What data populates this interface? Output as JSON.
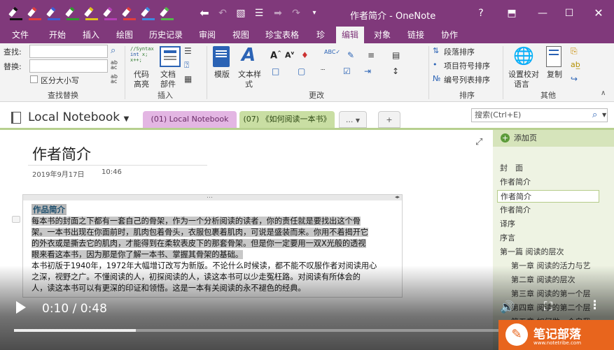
{
  "window": {
    "title": "作者简介 - OneNote",
    "help_label": "?",
    "controls": [
      "restore-ribbon",
      "minimize",
      "maximize",
      "close"
    ]
  },
  "pens": [
    {
      "color": "#111111"
    },
    {
      "color": "#e23d3d"
    },
    {
      "color": "#3b5ed6"
    },
    {
      "color": "#2e9b2e"
    },
    {
      "color": "#e0c21b"
    },
    {
      "color": "#b53fb5"
    },
    {
      "color": "#e23d3d"
    },
    {
      "color": "#3c8ae0"
    },
    {
      "color": "#53b84a"
    }
  ],
  "menu": {
    "tabs": [
      "文件",
      "开始",
      "插入",
      "绘图",
      "历史记录",
      "审阅",
      "视图",
      "珍宝表格",
      "珍",
      "编辑",
      "对象",
      "链接",
      "协作"
    ],
    "active": "编辑"
  },
  "ribbon": {
    "find_label": "查找:",
    "replace_label": "替换:",
    "find_value": "",
    "replace_value": "",
    "match_case_label": "区分大小写",
    "code_label": "代码\n高亮",
    "code_label_1": "代码",
    "code_label_2": "高亮",
    "doc_parts_1": "文档",
    "doc_parts_2": "部件",
    "template_label": "模版",
    "text_style_1": "文本样",
    "text_style_2": "式",
    "sort_paragraph": "段落排序",
    "sort_bullets": "项目符号排序",
    "sort_numbers": "编号列表排序",
    "proof_lang_1": "设置校对",
    "proof_lang_2": "语言",
    "copy_label": "复制",
    "groups": {
      "find_replace": "查找替换",
      "insert": "插入",
      "change": "更改",
      "sort": "排序",
      "other": "其他"
    }
  },
  "notebook": {
    "name": "Local Notebook",
    "sections": [
      {
        "label": "(01) Local Notebook",
        "color": "#e3b6e3"
      },
      {
        "label": "(07) 《如何阅读一本书》",
        "color": "#c9dea3"
      }
    ],
    "more_tab": "...",
    "add_tab": "+",
    "search_placeholder": "搜索(Ctrl+E)"
  },
  "page": {
    "title": "作者简介",
    "date": "2019年9月17日",
    "time": "10:46",
    "heading": "作品简介",
    "lines": [
      "每本书的封面之下都有一套自己的骨架，作为一个分析阅读的读者，你的责任就是要找出这个骨",
      "架。一本书出现在你面前时，肌肉包着骨头，衣服包裹着肌肉，可说是盛装而来。你用不着揭开它",
      "的外衣或是撕去它的肌肉，才能得到在柔软表皮下的那套骨架。但是你一定要用一双X光般的透视",
      "眼来看这本书，因为那是你了解一本书、掌握其骨架的基础。",
      "本书初版于1940年，1972年大幅增订改写为新版。不论什么时候读，都不能不叹服作者对阅读用心",
      "之深，视野之广。不懂阅读的人，初探阅读的人，读这本书可以少走冤枉路。对阅读有所体会的",
      "人，读这本书可以有更深的印证和领悟。这是一本有关阅读的永不褪色的经典。"
    ],
    "highlighted_lines": 4
  },
  "pages_pane": {
    "add_page_label": "添加页",
    "items": [
      {
        "label": "封　面",
        "level": 0,
        "selected": false
      },
      {
        "label": "作者简介",
        "level": 0,
        "selected": false
      },
      {
        "label": "作者简介",
        "level": 0,
        "selected": true
      },
      {
        "label": "作者简介",
        "level": 0,
        "selected": false
      },
      {
        "label": "译序",
        "level": 0,
        "selected": false
      },
      {
        "label": "序言",
        "level": 0,
        "selected": false
      },
      {
        "label": "第一篇 阅读的层次",
        "level": 0,
        "selected": false
      },
      {
        "label": "第一章 阅读的活力与艺",
        "level": 1,
        "selected": false
      },
      {
        "label": "第二章 阅读的层次",
        "level": 1,
        "selected": false
      },
      {
        "label": "第三章 阅读的第一个层",
        "level": 1,
        "selected": false
      },
      {
        "label": "第四章 阅读的第二个层",
        "level": 1,
        "selected": false
      },
      {
        "label": "第五章 如何做一个自我",
        "level": 1,
        "selected": false
      }
    ]
  },
  "video": {
    "current": "0:10",
    "duration": "0:48",
    "timecode": "0:10 / 0:48",
    "progress": 0.2083
  },
  "watermark": {
    "text": "笔记部落",
    "url": "www.notetribe.com"
  }
}
